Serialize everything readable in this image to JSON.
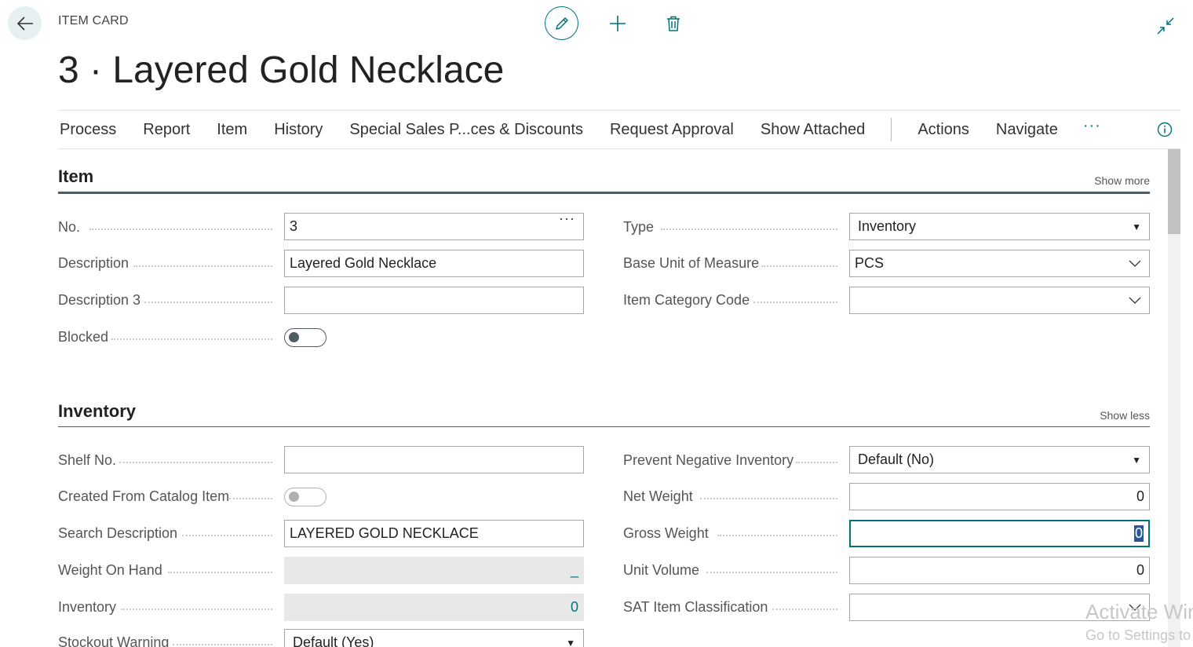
{
  "header": {
    "page_kind": "ITEM CARD",
    "title": "3 · Layered Gold Necklace"
  },
  "icons": {
    "back": "arrow-left-icon",
    "edit": "pencil-icon",
    "new": "plus-icon",
    "delete": "trash-icon",
    "collapse": "collapse-arrows-icon",
    "info": "info-icon",
    "more": "ellipsis-icon"
  },
  "colors": {
    "accent": "#00737a",
    "section_rule": "#505c64",
    "readonly_bg": "#e8e8e8"
  },
  "action_bar": {
    "items": [
      "Process",
      "Report",
      "Item",
      "History",
      "Special Sales P...ces & Discounts",
      "Request Approval",
      "Show Attached"
    ],
    "secondary": [
      "Actions",
      "Navigate"
    ],
    "more_label": "···"
  },
  "item_section": {
    "title": "Item",
    "link": "Show more",
    "no": {
      "label": "No.",
      "value": "3",
      "button": "···"
    },
    "description": {
      "label": "Description",
      "value": "Layered Gold Necklace"
    },
    "description3": {
      "label": "Description 3",
      "value": ""
    },
    "blocked": {
      "label": "Blocked",
      "on": false
    },
    "type": {
      "label": "Type",
      "value": "Inventory"
    },
    "base_uom": {
      "label": "Base Unit of Measure",
      "value": "PCS"
    },
    "item_category": {
      "label": "Item Category Code",
      "value": ""
    }
  },
  "inventory_section": {
    "title": "Inventory",
    "link": "Show less",
    "shelf_no": {
      "label": "Shelf No.",
      "value": ""
    },
    "created_from_catalog": {
      "label": "Created From Catalog Item",
      "on": false
    },
    "search_description": {
      "label": "Search Description",
      "value": "LAYERED GOLD NECKLACE"
    },
    "weight_on_hand": {
      "label": "Weight On Hand",
      "value": "_"
    },
    "inventory": {
      "label": "Inventory",
      "value": "0"
    },
    "stockout_warning": {
      "label": "Stockout Warning",
      "value": "Default (Yes)"
    },
    "prevent_negative": {
      "label": "Prevent Negative Inventory",
      "value": "Default (No)"
    },
    "net_weight": {
      "label": "Net Weight",
      "value": "0"
    },
    "gross_weight": {
      "label": "Gross Weight",
      "value": "0"
    },
    "unit_volume": {
      "label": "Unit Volume",
      "value": "0"
    },
    "sat_classification": {
      "label": "SAT Item Classification",
      "value": ""
    }
  },
  "watermark": {
    "line1": "Activate Win",
    "line2": "Go to Settings to"
  }
}
